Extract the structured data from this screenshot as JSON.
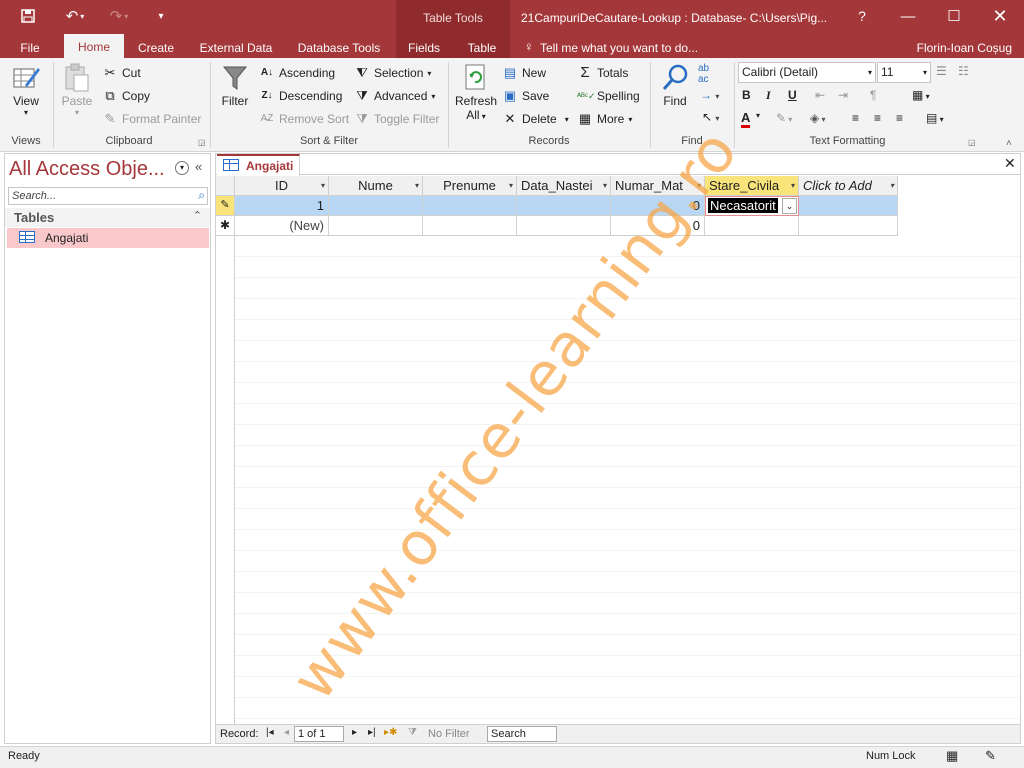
{
  "app": {
    "title": "21CampuriDeCautare-Lookup : Database- C:\\Users\\Pig...",
    "context_tab": "Table Tools",
    "help": "?",
    "user": "Florin-Ioan Coșug",
    "tell_me": "Tell me what you want to do..."
  },
  "tabs": [
    "File",
    "Home",
    "Create",
    "External Data",
    "Database Tools",
    "Fields",
    "Table"
  ],
  "ribbon": {
    "views": {
      "view": "View",
      "label": "Views"
    },
    "clipboard": {
      "paste": "Paste",
      "cut": "Cut",
      "copy": "Copy",
      "format_painter": "Format Painter",
      "label": "Clipboard"
    },
    "sort_filter": {
      "filter": "Filter",
      "ascending": "Ascending",
      "descending": "Descending",
      "remove_sort": "Remove Sort",
      "selection": "Selection",
      "advanced": "Advanced",
      "toggle_filter": "Toggle Filter",
      "label": "Sort & Filter"
    },
    "records": {
      "refresh": "Refresh",
      "refresh_all": "All",
      "new": "New",
      "save": "Save",
      "delete": "Delete",
      "totals": "Totals",
      "spelling": "Spelling",
      "more": "More",
      "label": "Records"
    },
    "find": {
      "find": "Find",
      "label": "Find"
    },
    "text_formatting": {
      "font": "Calibri (Detail)",
      "size": "11",
      "label": "Text Formatting"
    }
  },
  "nav": {
    "title": "All Access Obje...",
    "search_placeholder": "Search...",
    "section": "Tables",
    "items": [
      "Angajati"
    ]
  },
  "doc": {
    "tab": "Angajati",
    "columns": [
      "ID",
      "Nume",
      "Prenume",
      "Data_Nastei",
      "Numar_Mat",
      "Stare_Civila",
      "Click to Add"
    ],
    "rows": [
      {
        "id": "1",
        "numar": "0",
        "stare": "Necasatorit"
      },
      {
        "id": "(New)",
        "numar": "0",
        "stare": ""
      }
    ]
  },
  "recordnav": {
    "label": "Record:",
    "position": "1 of 1",
    "filter": "No Filter",
    "search": "Search"
  },
  "status": {
    "left": "Ready",
    "numlock": "Num Lock"
  },
  "watermark": "www.office-learning.ro",
  "colors": {
    "accent": "#a4373a",
    "selected_row": "#b8d7f5",
    "highlight_header": "#f8e47a"
  }
}
